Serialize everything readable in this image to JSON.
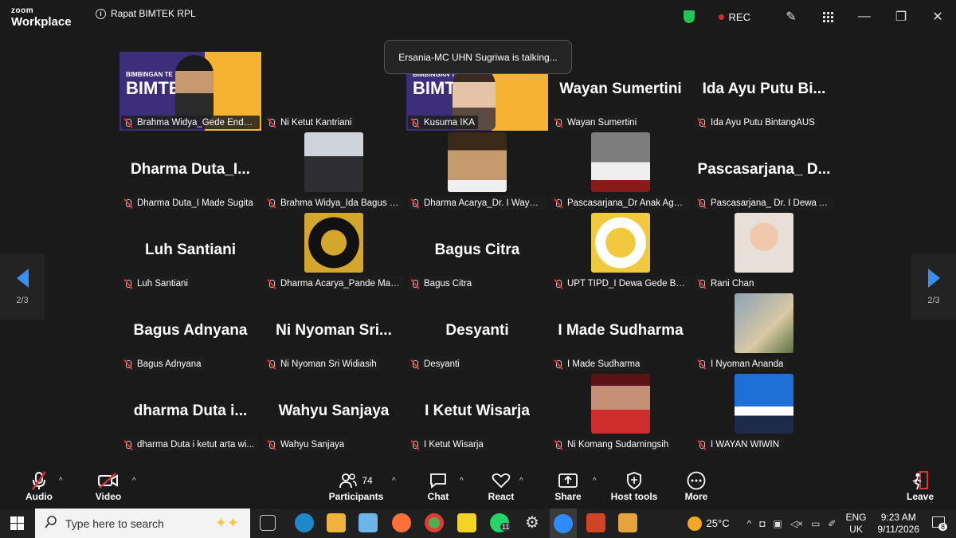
{
  "app": {
    "logo_line1": "zoom",
    "logo_line2": "Workplace",
    "meeting_title": "Rapat BIMTEK RPL",
    "rec_label": "REC"
  },
  "toast": "Ersania-MC UHN Sugriwa is talking...",
  "pagination": {
    "left": "2/3",
    "right": "2/3"
  },
  "tiles": [
    {
      "name": "Brahma Widya_Gede Endy K...",
      "big": "",
      "kind": "video1"
    },
    {
      "name": "Ni Ketut Kantriani",
      "big": "",
      "kind": "blank"
    },
    {
      "name": "Kusuma IKA",
      "big": "",
      "kind": "video2"
    },
    {
      "name": "Wayan Sumertini",
      "big": "Wayan Sumertini",
      "kind": "text"
    },
    {
      "name": "Ida Ayu Putu BintangAUS",
      "big": "Ida Ayu Putu Bi...",
      "kind": "text"
    },
    {
      "name": "Dharma Duta_I Made Sugita",
      "big": "Dharma Duta_I...",
      "kind": "text"
    },
    {
      "name": "Brahma Widya_Ida Bagus P...",
      "big": "",
      "kind": "photo-suit"
    },
    {
      "name": "Dharma Acarya_Dr. I Wayan ...",
      "big": "",
      "kind": "photo-face"
    },
    {
      "name": "Pascasarjana_Dr Anak Agun...",
      "big": "",
      "kind": "photo-red"
    },
    {
      "name": "Pascasarjana_ Dr. I Dewa Ay...",
      "big": "Pascasarjana_ D...",
      "kind": "text"
    },
    {
      "name": "Luh Santiani",
      "big": "Luh Santiani",
      "kind": "text"
    },
    {
      "name": "Dharma Acarya_Pande Mad...",
      "big": "",
      "kind": "logo-dark"
    },
    {
      "name": "Bagus Citra",
      "big": "Bagus Citra",
      "kind": "text"
    },
    {
      "name": "UPT TIPD_I Dewa Gede Budi...",
      "big": "",
      "kind": "logo-light"
    },
    {
      "name": "Rani Chan",
      "big": "",
      "kind": "photo-girl"
    },
    {
      "name": "Bagus Adnyana",
      "big": "Bagus Adnyana",
      "kind": "text"
    },
    {
      "name": "Ni Nyoman Sri Widiasih",
      "big": "Ni Nyoman Sri...",
      "kind": "text"
    },
    {
      "name": "Desyanti",
      "big": "Desyanti",
      "kind": "text"
    },
    {
      "name": "I Made Sudharma",
      "big": "I Made Sudharma",
      "kind": "text"
    },
    {
      "name": "I Nyoman Ananda",
      "big": "",
      "kind": "photo-group"
    },
    {
      "name": "dharma Duta i ketut arta wi...",
      "big": "dharma Duta i...",
      "kind": "text"
    },
    {
      "name": "Wahyu Sanjaya",
      "big": "Wahyu Sanjaya",
      "kind": "text"
    },
    {
      "name": "I Ketut Wisarja",
      "big": "I Ketut Wisarja",
      "kind": "text"
    },
    {
      "name": "Ni Komang Sudarningsih",
      "big": "",
      "kind": "photo-woman"
    },
    {
      "name": "I WAYAN WIWIN",
      "big": "",
      "kind": "photo-blue"
    }
  ],
  "video_banner": {
    "line1": "BIMBINGAN TE",
    "line2": "BIMTE"
  },
  "toolbar": {
    "audio": "Audio",
    "video": "Video",
    "participants": "Participants",
    "participants_count": "74",
    "chat": "Chat",
    "react": "React",
    "share": "Share",
    "host_tools": "Host tools",
    "more": "More",
    "leave": "Leave"
  },
  "taskbar": {
    "search_placeholder": "Type here to search",
    "temperature": "25°C",
    "lang1": "ENG",
    "lang2": "UK",
    "time": "9:23 AM",
    "date": "9/11/2026",
    "whatsapp_badge": "11",
    "notif_badge": "8"
  },
  "colors": {
    "accent": "#3a8eed",
    "rec": "#e02828",
    "shield": "#23c552"
  }
}
